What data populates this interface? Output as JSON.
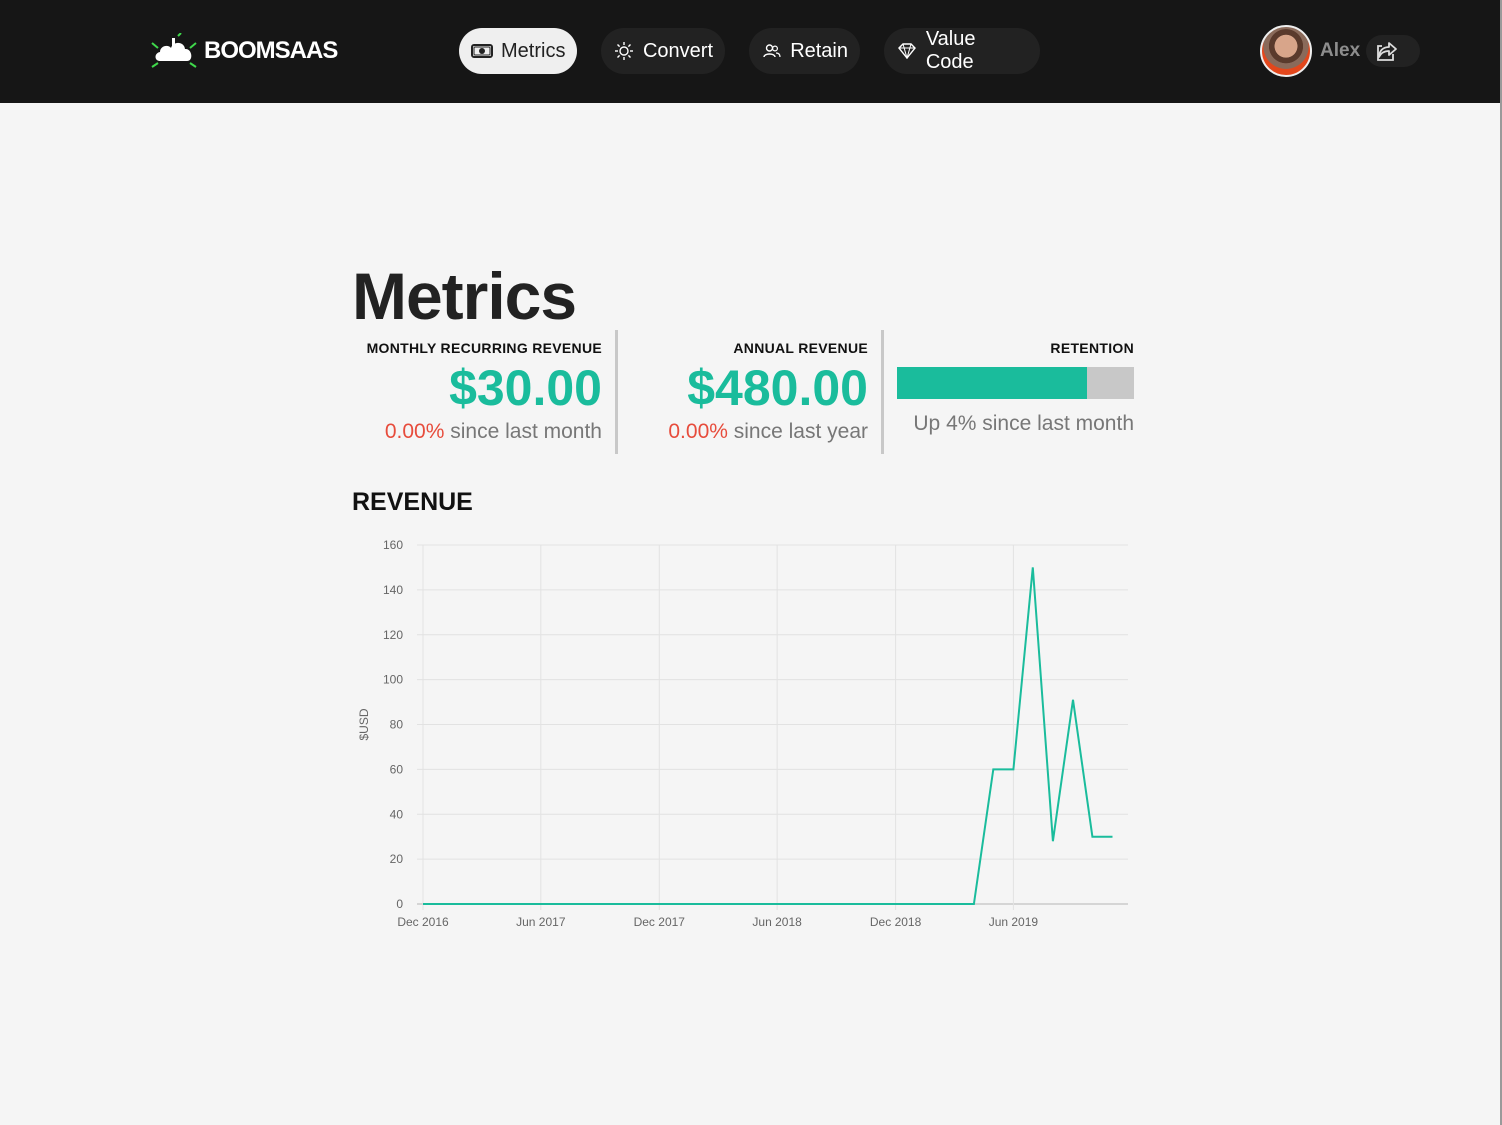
{
  "app": {
    "brand": "BOOMSAAS",
    "nav": [
      {
        "label": "Metrics",
        "icon": "money-icon",
        "active": true
      },
      {
        "label": "Convert",
        "icon": "sun-icon",
        "active": false
      },
      {
        "label": "Retain",
        "icon": "users-icon",
        "active": false
      },
      {
        "label": "Value Code",
        "icon": "diamond-icon",
        "active": false
      }
    ],
    "user": {
      "name": "Alex"
    }
  },
  "page": {
    "title": "Metrics",
    "kpis": {
      "mrr": {
        "label": "MONTHLY RECURRING REVENUE",
        "value": "$30.00",
        "change": "0.00%",
        "suffix": "since last month"
      },
      "arr": {
        "label": "ANNUAL REVENUE",
        "value": "$480.00",
        "change": "0.00%",
        "suffix": "since last year"
      },
      "retention": {
        "label": "RETENTION",
        "level": 0.8,
        "text": "Up 4% since last month"
      }
    },
    "revenue_title": "REVENUE"
  },
  "colors": {
    "accent": "#1abc9c",
    "negative": "#e74c3c",
    "topbar": "#161616"
  },
  "chart_data": {
    "type": "line",
    "ylabel": "$USD",
    "ylim": [
      0,
      160
    ],
    "yticks": [
      0,
      20,
      40,
      60,
      80,
      100,
      120,
      140,
      160
    ],
    "xtick_labels": [
      "Dec 2016",
      "Jun 2017",
      "Dec 2017",
      "Jun 2018",
      "Dec 2018",
      "Jun 2019"
    ],
    "xtick_dates": [
      "2016-12-01",
      "2017-06-01",
      "2017-12-01",
      "2018-06-01",
      "2018-12-01",
      "2019-06-01"
    ],
    "x_range": [
      "2016-12-01",
      "2019-11-25"
    ],
    "grid": true,
    "series": [
      {
        "x": [
          "2016-12-01",
          "2017-06-01",
          "2017-12-01",
          "2018-06-01",
          "2018-12-01",
          "2019-03-01",
          "2019-04-01",
          "2019-05-01",
          "2019-06-01",
          "2019-07-01",
          "2019-08-01",
          "2019-09-01",
          "2019-10-01",
          "2019-11-01"
        ],
        "values": [
          0,
          0,
          0,
          0,
          0,
          0,
          0,
          60,
          60,
          150,
          28,
          91,
          30,
          30
        ]
      }
    ]
  }
}
